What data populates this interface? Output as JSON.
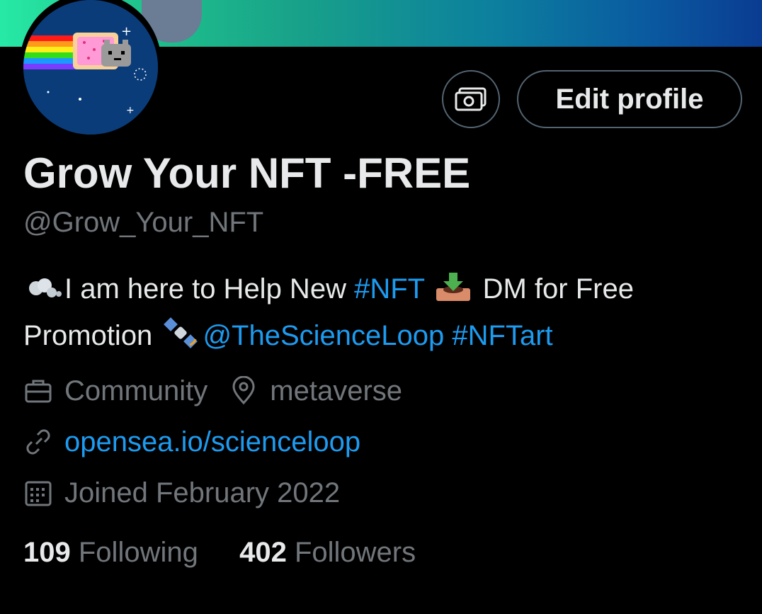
{
  "profile": {
    "display_name": "Grow Your NFT -FREE",
    "handle": "@Grow_Your_NFT",
    "edit_button": "Edit profile",
    "tip_icon": "money-icon",
    "bio": {
      "part1": "I am here to Help New",
      "hashtag1": "#NFT",
      "part2": "DM for Free Promotion",
      "mention": "@TheScienceLoop",
      "hashtag2": "#NFTart"
    },
    "category": "Community",
    "location": "metaverse",
    "website": "opensea.io/scienceloop",
    "joined": "Joined February 2022",
    "following_count": "109",
    "following_label": "Following",
    "followers_count": "402",
    "followers_label": "Followers"
  },
  "colors": {
    "background": "#000000",
    "text": "#e7e9ea",
    "secondary": "#71767b",
    "accent": "#1d9bf0",
    "border": "#536471"
  }
}
